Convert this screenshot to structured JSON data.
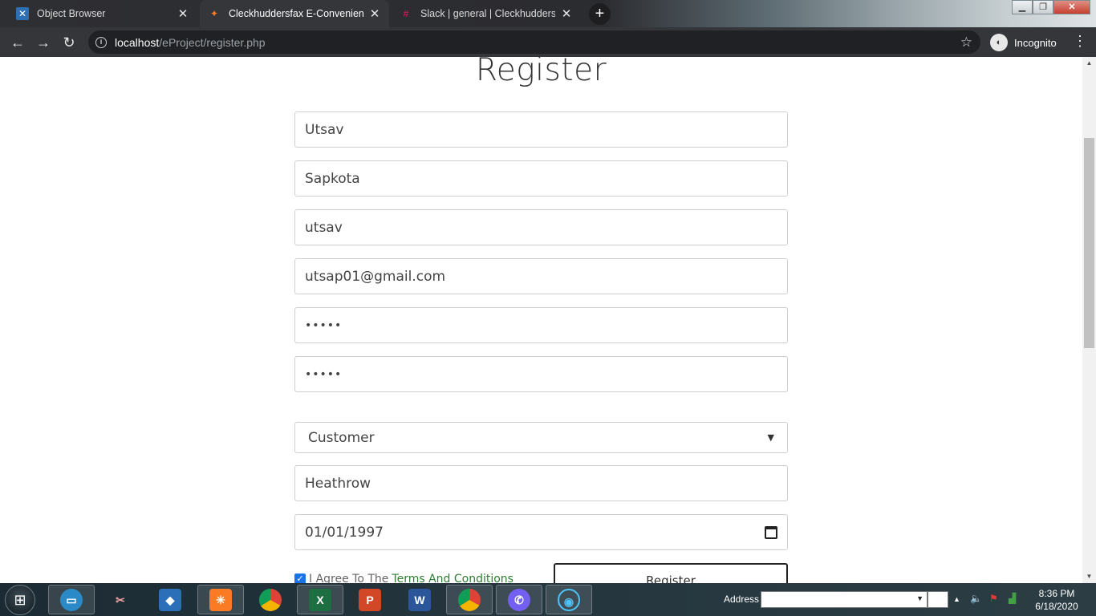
{
  "browser": {
    "tabs": [
      {
        "title": "Object Browser",
        "icon": "object-browser-icon",
        "active": false
      },
      {
        "title": "Cleckhuddersfax E-Convenient St",
        "icon": "xampp-icon",
        "active": true
      },
      {
        "title": "Slack | general | Cleckhuddersfax",
        "icon": "slack-icon",
        "active": false
      }
    ],
    "url_host": "localhost",
    "url_path": "/eProject/register.php",
    "profile_label": "Incognito"
  },
  "form": {
    "title": "Register",
    "first_name": "Utsav",
    "last_name": "Sapkota",
    "username": "utsav",
    "email": "utsap01@gmail.com",
    "password_mask": "•••••",
    "confirm_password_mask": "•••••",
    "role_selected": "Customer",
    "address": "Heathrow",
    "dob": "01/01/1997",
    "agree_prefix": "I Agree To The",
    "agree_link": "Terms And Conditions",
    "submit_label": "Register"
  },
  "taskbar": {
    "address_label": "Address",
    "time": "8:36 PM",
    "date": "6/18/2020"
  },
  "colors": {
    "accent_link": "#2e7d32",
    "checkbox": "#1a73e8",
    "browser_chrome": "#35363a"
  }
}
